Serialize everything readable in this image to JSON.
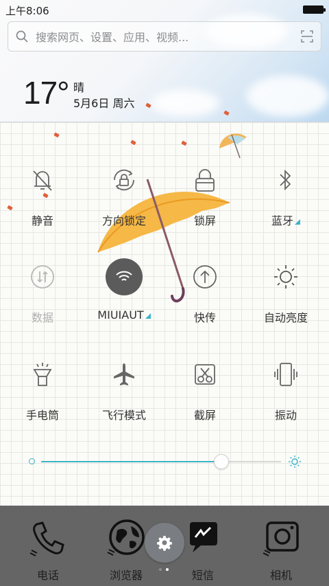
{
  "status_bar": {
    "time": "上午8:06"
  },
  "search": {
    "placeholder": "搜索网页、设置、应用、视频..."
  },
  "weather": {
    "temperature": "17°",
    "condition": "晴",
    "date": "5月6日 周六"
  },
  "quick_toggles": [
    {
      "label": "静音",
      "icon": "mute-bell-icon",
      "state": "off"
    },
    {
      "label": "方向锁定",
      "icon": "rotation-lock-icon",
      "state": "off"
    },
    {
      "label": "锁屏",
      "icon": "lock-icon",
      "state": "off"
    },
    {
      "label": "蓝牙",
      "icon": "bluetooth-icon",
      "state": "off",
      "has_menu": true
    },
    {
      "label": "数据",
      "icon": "mobile-data-icon",
      "state": "disabled"
    },
    {
      "label": "MIUIAUT",
      "icon": "wifi-icon",
      "state": "on",
      "has_menu": true
    },
    {
      "label": "快传",
      "icon": "quick-transfer-icon",
      "state": "off"
    },
    {
      "label": "自动亮度",
      "icon": "auto-brightness-icon",
      "state": "off"
    },
    {
      "label": "手电筒",
      "icon": "flashlight-icon",
      "state": "off"
    },
    {
      "label": "飞行模式",
      "icon": "airplane-icon",
      "state": "off"
    },
    {
      "label": "截屏",
      "icon": "screenshot-icon",
      "state": "off"
    },
    {
      "label": "振动",
      "icon": "vibrate-icon",
      "state": "off"
    }
  ],
  "brightness": {
    "level": 0.75
  },
  "dock": [
    {
      "label": "电话",
      "icon": "phone-icon"
    },
    {
      "label": "浏览器",
      "icon": "browser-globe-icon"
    },
    {
      "label": "短信",
      "icon": "message-icon"
    },
    {
      "label": "相机",
      "icon": "camera-icon"
    }
  ],
  "page_indicator": {
    "count": 2,
    "active": 1
  },
  "colors": {
    "accent": "#3bb4c9",
    "wifi_on_bg": "#5b5b5b",
    "dock_bg": "#5f5f5f",
    "umbrella": "#f6b43c"
  }
}
